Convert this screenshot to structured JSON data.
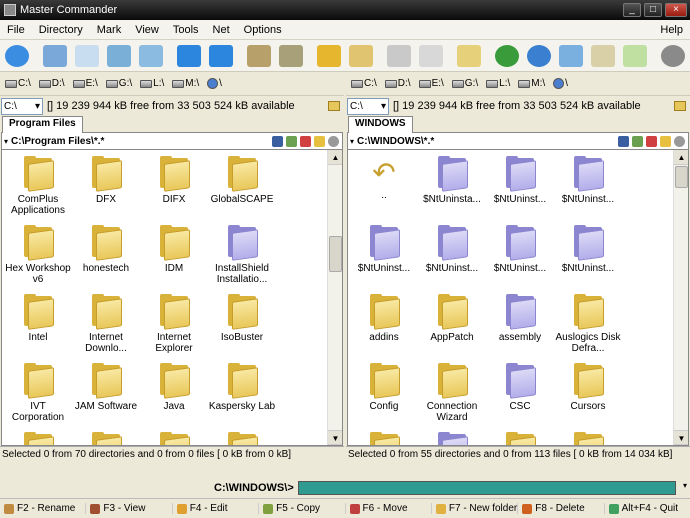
{
  "window": {
    "title": "Master Commander"
  },
  "menu": [
    "File",
    "Directory",
    "Mark",
    "View",
    "Tools",
    "Net",
    "Options",
    "Help"
  ],
  "toolbar": [
    {
      "icon": "refresh-icon",
      "color": "#3a8de0"
    },
    {
      "icon": "view-list-icon",
      "color": "#7aa8d8"
    },
    {
      "icon": "view-icons-icon",
      "color": "#c9ddf0"
    },
    {
      "icon": "view-grid-icon",
      "color": "#7ab0d8"
    },
    {
      "icon": "view-details-icon",
      "color": "#8bbbe0"
    },
    {
      "icon": "back-arrow-icon",
      "color": "#2c86dd"
    },
    {
      "icon": "forward-arrow-icon",
      "color": "#2c86dd"
    },
    {
      "icon": "copy-folder-icon",
      "color": "#b8a06a"
    },
    {
      "icon": "move-folder-icon",
      "color": "#a8a078"
    },
    {
      "icon": "lock-icon",
      "color": "#e6b62e"
    },
    {
      "icon": "unlock-icon",
      "color": "#e0c470"
    },
    {
      "icon": "search-icon",
      "color": "#c9c9c9"
    },
    {
      "icon": "pencil-icon",
      "color": "#d8d8d8"
    },
    {
      "icon": "edit-document-icon",
      "color": "#e7d07a"
    },
    {
      "icon": "globe-icon",
      "color": "#3a9b3a"
    },
    {
      "icon": "network-globe-icon",
      "color": "#3a7fd0"
    },
    {
      "icon": "connect-icon",
      "color": "#7ab0e0"
    },
    {
      "icon": "panels-icon",
      "color": "#d9d0a8"
    },
    {
      "icon": "sync-icon",
      "color": "#bfe0a0"
    },
    {
      "icon": "settings-gear-icon",
      "color": "#8a8a8a"
    }
  ],
  "drives": [
    "C:\\",
    "D:\\",
    "E:\\",
    "G:\\",
    "L:\\",
    "M:\\",
    "\\"
  ],
  "left": {
    "drive": "C:\\",
    "free": "[] 19 239 944 kB free from 33 503 524 kB available",
    "tab": "Program Files",
    "path": "C:\\Program Files\\*.*",
    "items": [
      {
        "name": "ComPlus Applications",
        "color": "yellow"
      },
      {
        "name": "DFX",
        "color": "yellow"
      },
      {
        "name": "DIFX",
        "color": "yellow"
      },
      {
        "name": "GlobalSCAPE",
        "color": "yellow"
      },
      {
        "name": "Hex Workshop v6",
        "color": "yellow"
      },
      {
        "name": "honestech",
        "color": "yellow"
      },
      {
        "name": "IDM",
        "color": "yellow"
      },
      {
        "name": "InstallShield Installatio...",
        "color": "purple"
      },
      {
        "name": "Intel",
        "color": "yellow"
      },
      {
        "name": "Internet Downlo...",
        "color": "yellow"
      },
      {
        "name": "Internet Explorer",
        "color": "yellow"
      },
      {
        "name": "IsoBuster",
        "color": "yellow"
      },
      {
        "name": "IVT Corporation",
        "color": "yellow"
      },
      {
        "name": "JAM Software",
        "color": "yellow"
      },
      {
        "name": "Java",
        "color": "yellow"
      },
      {
        "name": "Kaspersky Lab",
        "color": "yellow"
      },
      {
        "name": "",
        "color": "yellow"
      },
      {
        "name": "",
        "color": "yellow"
      },
      {
        "name": "",
        "color": "yellow"
      },
      {
        "name": "",
        "color": "yellow"
      }
    ],
    "status": "Selected 0 from 70 directories and 0 from 0 files [ 0 kB from 0 kB]"
  },
  "right": {
    "drive": "C:\\",
    "free": "[] 19 239 944 kB free from 33 503 524 kB available",
    "tab": "WINDOWS",
    "path": "C:\\WINDOWS\\*.*",
    "items": [
      {
        "name": "..",
        "color": "up"
      },
      {
        "name": "$NtUninsta...",
        "color": "purple"
      },
      {
        "name": "$NtUninst...",
        "color": "purple"
      },
      {
        "name": "$NtUninst...",
        "color": "purple"
      },
      {
        "name": "$NtUninst...",
        "color": "purple"
      },
      {
        "name": "$NtUninst...",
        "color": "purple"
      },
      {
        "name": "$NtUninst...",
        "color": "purple"
      },
      {
        "name": "$NtUninst...",
        "color": "purple"
      },
      {
        "name": "addins",
        "color": "yellow"
      },
      {
        "name": "AppPatch",
        "color": "yellow"
      },
      {
        "name": "assembly",
        "color": "purple"
      },
      {
        "name": "Auslogics Disk Defra...",
        "color": "yellow"
      },
      {
        "name": "Config",
        "color": "yellow"
      },
      {
        "name": "Connection Wizard",
        "color": "yellow"
      },
      {
        "name": "CSC",
        "color": "purple"
      },
      {
        "name": "Cursors",
        "color": "yellow"
      },
      {
        "name": "",
        "color": "yellow"
      },
      {
        "name": "",
        "color": "purple"
      },
      {
        "name": "",
        "color": "yellow"
      },
      {
        "name": "",
        "color": "yellow"
      }
    ],
    "status": "Selected 0 from 55 directories and 0 from 113 files [ 0 kB from 14 034 kB]"
  },
  "cmdline": {
    "path": "C:\\WINDOWS\\>",
    "value": ""
  },
  "fkeys": [
    {
      "label": "F2 - Rename",
      "color": "#c08a40"
    },
    {
      "label": "F3 - View",
      "color": "#a05030"
    },
    {
      "label": "F4 - Edit",
      "color": "#e0a030"
    },
    {
      "label": "F5 - Copy",
      "color": "#80a040"
    },
    {
      "label": "F6 - Move",
      "color": "#c04040"
    },
    {
      "label": "F7 - New folder",
      "color": "#e0b040"
    },
    {
      "label": "F8 - Delete",
      "color": "#d06020"
    },
    {
      "label": "Alt+F4 - Quit",
      "color": "#40a060"
    }
  ]
}
